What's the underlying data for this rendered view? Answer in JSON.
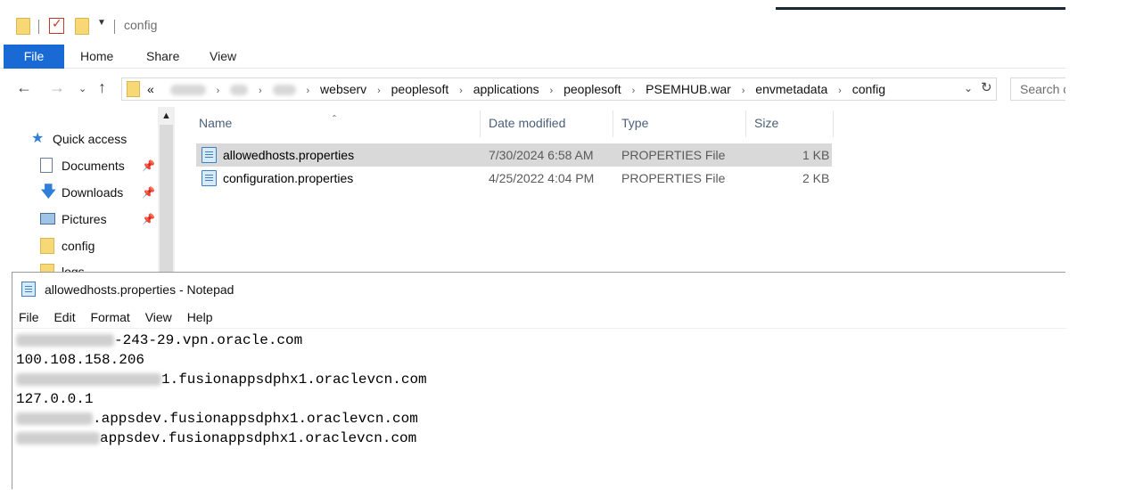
{
  "explorer": {
    "title": "config",
    "ribbon_tabs": [
      "File",
      "Home",
      "Share",
      "View"
    ],
    "breadcrumb": {
      "lead": "«",
      "visible": [
        "webserv",
        "peoplesoft",
        "applications",
        "peoplesoft",
        "PSEMHUB.war",
        "envmetadata",
        "config"
      ]
    },
    "search_placeholder": "Search c",
    "nav_pane": [
      {
        "label": "Quick access",
        "icon": "star-icon",
        "pinned": false
      },
      {
        "label": "Documents",
        "icon": "documents-icon",
        "pinned": true
      },
      {
        "label": "Downloads",
        "icon": "download-icon",
        "pinned": true
      },
      {
        "label": "Pictures",
        "icon": "pictures-icon",
        "pinned": true
      },
      {
        "label": "config",
        "icon": "folder-icon",
        "pinned": false
      },
      {
        "label": "logs",
        "icon": "folder-icon",
        "pinned": false
      }
    ],
    "columns": [
      "Name",
      "Date modified",
      "Type",
      "Size"
    ],
    "files": [
      {
        "name": "allowedhosts.properties",
        "date": "7/30/2024 6:58 AM",
        "type": "PROPERTIES File",
        "size": "1 KB",
        "selected": true
      },
      {
        "name": "configuration.properties",
        "date": "4/25/2022 4:04 PM",
        "type": "PROPERTIES File",
        "size": "2 KB",
        "selected": false
      }
    ]
  },
  "notepad": {
    "title": "allowedhosts.properties - Notepad",
    "menu": [
      "File",
      "Edit",
      "Format",
      "View",
      "Help"
    ],
    "lines": [
      {
        "text": "-243-29.vpn.oracle.com"
      },
      {
        "text": "100.108.158.206"
      },
      {
        "text": "1.fusionappsdphx1.oraclevcn.com"
      },
      {
        "text": "127.0.0.1"
      },
      {
        "text": ".appsdev.fusionappsdphx1.oraclevcn.com"
      },
      {
        "text": "appsdev.fusionappsdphx1.oraclevcn.com"
      }
    ]
  },
  "colors": {
    "file_tab": "#1a6ad6",
    "selection": "#d9d9d9",
    "folder": "#f8d775",
    "header_text": "#4c607a"
  }
}
